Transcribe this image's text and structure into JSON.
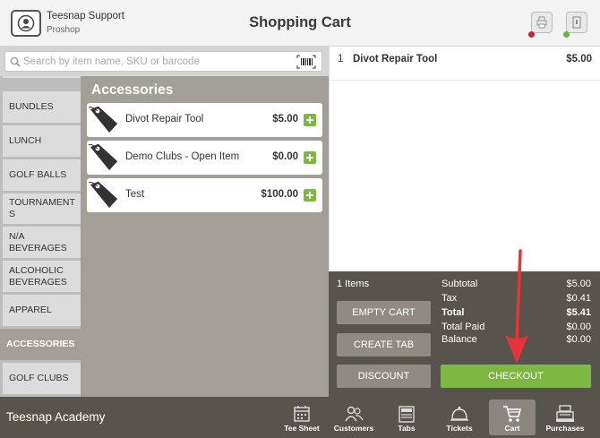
{
  "header": {
    "user_name": "Teesnap Support",
    "user_sub": "Proshop",
    "title": "Shopping Cart",
    "device_status": {
      "printer": "#c62828",
      "drawer": "#6ab04c"
    }
  },
  "search": {
    "placeholder": "Search by item name, SKU or barcode"
  },
  "sidebar": {
    "categories": [
      {
        "label": "BUNDLES",
        "active": false
      },
      {
        "label": "LUNCH",
        "active": false
      },
      {
        "label": "GOLF BALLS",
        "active": false
      },
      {
        "label": "TOURNAMENTS",
        "active": false
      },
      {
        "label": "N/A BEVERAGES",
        "active": false
      },
      {
        "label": "ALCOHOLIC BEVERAGES",
        "active": false
      },
      {
        "label": "APPAREL",
        "active": false
      },
      {
        "label": "ACCESSORIES",
        "active": true
      },
      {
        "label": "GOLF CLUBS",
        "active": false
      }
    ]
  },
  "products": {
    "title": "Accessories",
    "items": [
      {
        "name": "Divot Repair Tool",
        "price": "$5.00"
      },
      {
        "name": "Demo Clubs - Open Item",
        "price": "$0.00"
      },
      {
        "name": "Test",
        "price": "$100.00"
      }
    ]
  },
  "cart": {
    "items": [
      {
        "qty": "1",
        "name": "Divot Repair Tool",
        "price": "$5.00"
      }
    ]
  },
  "summary": {
    "items_count": "1 Items",
    "empty_cart": "EMPTY CART",
    "create_tab": "CREATE TAB",
    "discount": "DISCOUNT",
    "checkout": "CHECKOUT",
    "subtotal_label": "Subtotal",
    "subtotal": "$5.00",
    "tax_label": "Tax",
    "tax": "$0.41",
    "total_label": "Total",
    "total": "$5.41",
    "total_paid_label": "Total Paid",
    "total_paid": "$0.00",
    "balance_label": "Balance",
    "balance": "$0.00"
  },
  "bottom": {
    "academy": "Teesnap Academy",
    "nav": [
      {
        "label": "Tee Sheet",
        "icon": "calendar-icon",
        "active": false
      },
      {
        "label": "Customers",
        "icon": "customers-icon",
        "active": false
      },
      {
        "label": "Tabs",
        "icon": "tabs-icon",
        "active": false
      },
      {
        "label": "Tickets",
        "icon": "bell-icon",
        "active": false
      },
      {
        "label": "Cart",
        "icon": "cart-icon",
        "active": true
      },
      {
        "label": "Purchases",
        "icon": "register-icon",
        "active": false
      }
    ]
  },
  "colors": {
    "accent_green": "#7cb842",
    "annotation_red": "#e8323c",
    "panel_dark": "#57534d"
  }
}
